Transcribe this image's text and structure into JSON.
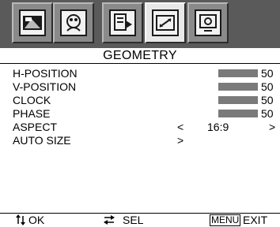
{
  "icons": [
    {
      "name": "picture-icon"
    },
    {
      "name": "color-icon"
    },
    {
      "name": "osd-settings-icon"
    },
    {
      "name": "geometry-icon",
      "active": true
    },
    {
      "name": "recall-icon"
    }
  ],
  "title": "GEOMETRY",
  "items": [
    {
      "label": "H-POSITION",
      "value": "50",
      "level": 0.5
    },
    {
      "label": "V-POSITION",
      "value": "50",
      "level": 0.5
    },
    {
      "label": "CLOCK",
      "value": "50",
      "level": 0.5
    },
    {
      "label": "PHASE",
      "value": "50",
      "level": 0.5
    }
  ],
  "aspect": {
    "label": "ASPECT",
    "value": "16:9",
    "left_arrow": "<",
    "right_arrow": ">"
  },
  "auto_size": {
    "label": "AUTO SIZE",
    "arrow": ">"
  },
  "footer": {
    "ok_label": "OK",
    "sel_label": "SEL",
    "menu_key": "MENU",
    "exit_label": "EXIT",
    "updown_icon": "up-down-arrows-icon",
    "leftright_icon": "left-right-arrows-icon"
  }
}
